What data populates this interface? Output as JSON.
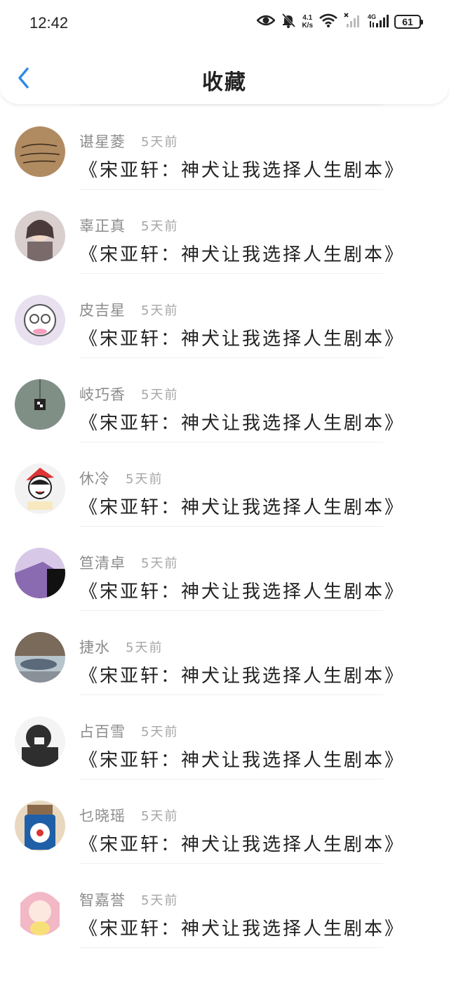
{
  "status_bar": {
    "time": "12:42",
    "net_speed_value": "4.1",
    "net_speed_unit": "K/s",
    "network_type": "4G",
    "battery": "61"
  },
  "header": {
    "title": "收藏",
    "back_icon": "chevron-left-icon"
  },
  "items": [
    {
      "name": "",
      "time": "",
      "title": "《宋亚轩：神犬让我选择人生剧本》"
    },
    {
      "name": "谌星菱",
      "time": "5天前",
      "title": "《宋亚轩：神犬让我选择人生剧本》"
    },
    {
      "name": "辜正真",
      "time": "5天前",
      "title": "《宋亚轩：神犬让我选择人生剧本》"
    },
    {
      "name": "皮吉星",
      "time": "5天前",
      "title": "《宋亚轩：神犬让我选择人生剧本》"
    },
    {
      "name": "岐巧香",
      "time": "5天前",
      "title": "《宋亚轩：神犬让我选择人生剧本》"
    },
    {
      "name": "休冷",
      "time": "5天前",
      "title": "《宋亚轩：神犬让我选择人生剧本》"
    },
    {
      "name": "笪清卓",
      "time": "5天前",
      "title": "《宋亚轩：神犬让我选择人生剧本》"
    },
    {
      "name": "捷水",
      "time": "5天前",
      "title": "《宋亚轩：神犬让我选择人生剧本》"
    },
    {
      "name": "占百雪",
      "time": "5天前",
      "title": "《宋亚轩：神犬让我选择人生剧本》"
    },
    {
      "name": "乜晓瑶",
      "time": "5天前",
      "title": "《宋亚轩：神犬让我选择人生剧本》"
    },
    {
      "name": "智嘉誉",
      "time": "5天前",
      "title": "《宋亚轩：神犬让我选择人生剧本》"
    }
  ],
  "avatar_colors": [
    "#6a8a9a",
    "#b08a60",
    "#7a6a6a",
    "#e8e0ee",
    "#7f8f86",
    "#f2f2f2",
    "#8a6ab0",
    "#5a6a7a",
    "#2e2e2e",
    "#8a6a4a",
    "#f2b8c6"
  ]
}
